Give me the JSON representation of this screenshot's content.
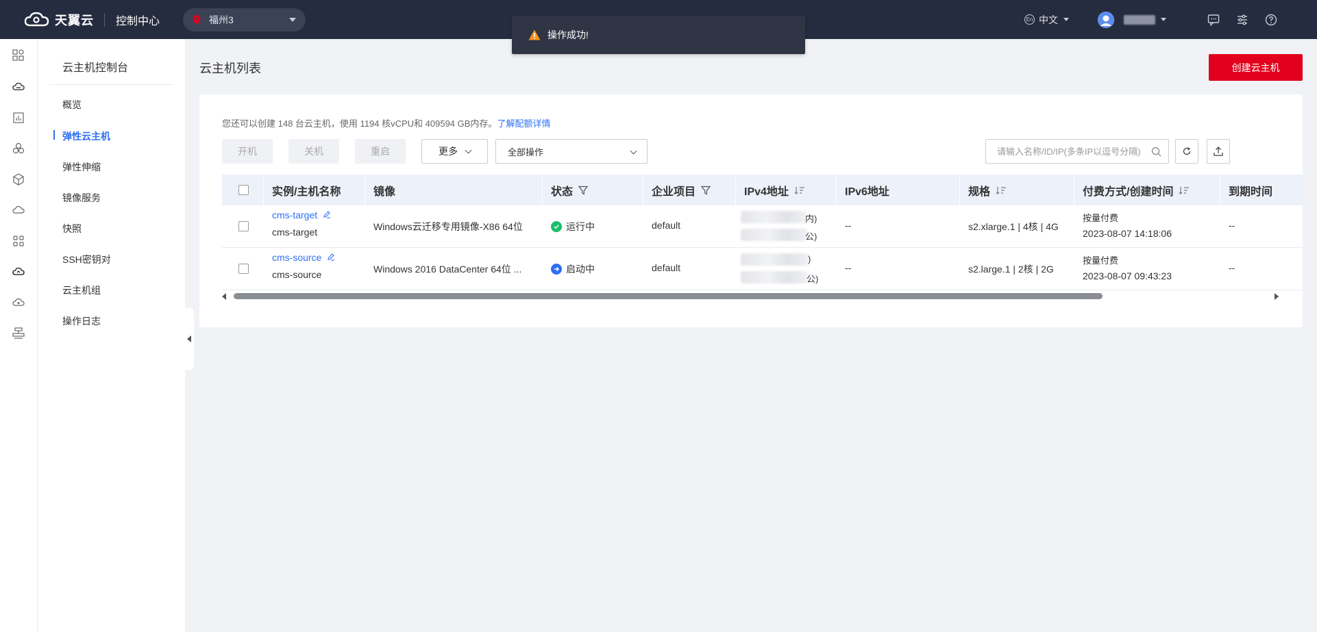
{
  "header": {
    "brand": "天翼云",
    "console": "控制中心",
    "region": "福州3",
    "language": "中文",
    "language_badge": "En"
  },
  "toast": {
    "message": "操作成功!"
  },
  "sidebar": {
    "title": "云主机控制台",
    "items": [
      {
        "label": "概览"
      },
      {
        "label": "弹性云主机",
        "active": true
      },
      {
        "label": "弹性伸缩"
      },
      {
        "label": "镜像服务"
      },
      {
        "label": "快照"
      },
      {
        "label": "SSH密钥对"
      },
      {
        "label": "云主机组"
      },
      {
        "label": "操作日志"
      }
    ]
  },
  "main": {
    "title": "云主机列表",
    "create_label": "创建云主机",
    "quota_text": "您还可以创建 148 台云主机，使用 1194 核vCPU和 409594 GB内存。",
    "quota_link": "了解配额详情",
    "toolbar": {
      "start": "开机",
      "stop": "关机",
      "restart": "重启",
      "more": "更多",
      "batch_select": "全部操作",
      "search_placeholder": "请输入名称/ID/IP(多条IP以逗号分隔)"
    },
    "table": {
      "columns": [
        "实例/主机名称",
        "镜像",
        "状态",
        "企业项目",
        "IPv4地址",
        "IPv6地址",
        "规格",
        "付费方式/创建时间",
        "到期时间"
      ],
      "rows": [
        {
          "name": "cms-target",
          "hostname": "cms-target",
          "image": "Windows云迁移专用镜像-X86 64位",
          "status": "运行中",
          "status_color": "#19be6b",
          "project": "default",
          "ip_suffix_1": "内)",
          "ip_suffix_2": "公)",
          "ipv6": "--",
          "spec": "s2.xlarge.1 | 4核 | 4G",
          "billing": "按量付费",
          "created": "2023-08-07 14:18:06",
          "expire": "--"
        },
        {
          "name": "cms-source",
          "hostname": "cms-source",
          "image": "Windows 2016 DataCenter 64位 ...",
          "status": "启动中",
          "status_color": "#2e6ff3",
          "project": "default",
          "ip_suffix_1": ")",
          "ip_suffix_2": "公)",
          "ipv6": "--",
          "spec": "s2.large.1 | 2核 | 2G",
          "billing": "按量付费",
          "created": "2023-08-07 09:43:23",
          "expire": "--"
        }
      ]
    }
  },
  "colors": {
    "accent": "#2e6ff3",
    "brand_red": "#e2001e",
    "topbar": "#262c3f"
  }
}
